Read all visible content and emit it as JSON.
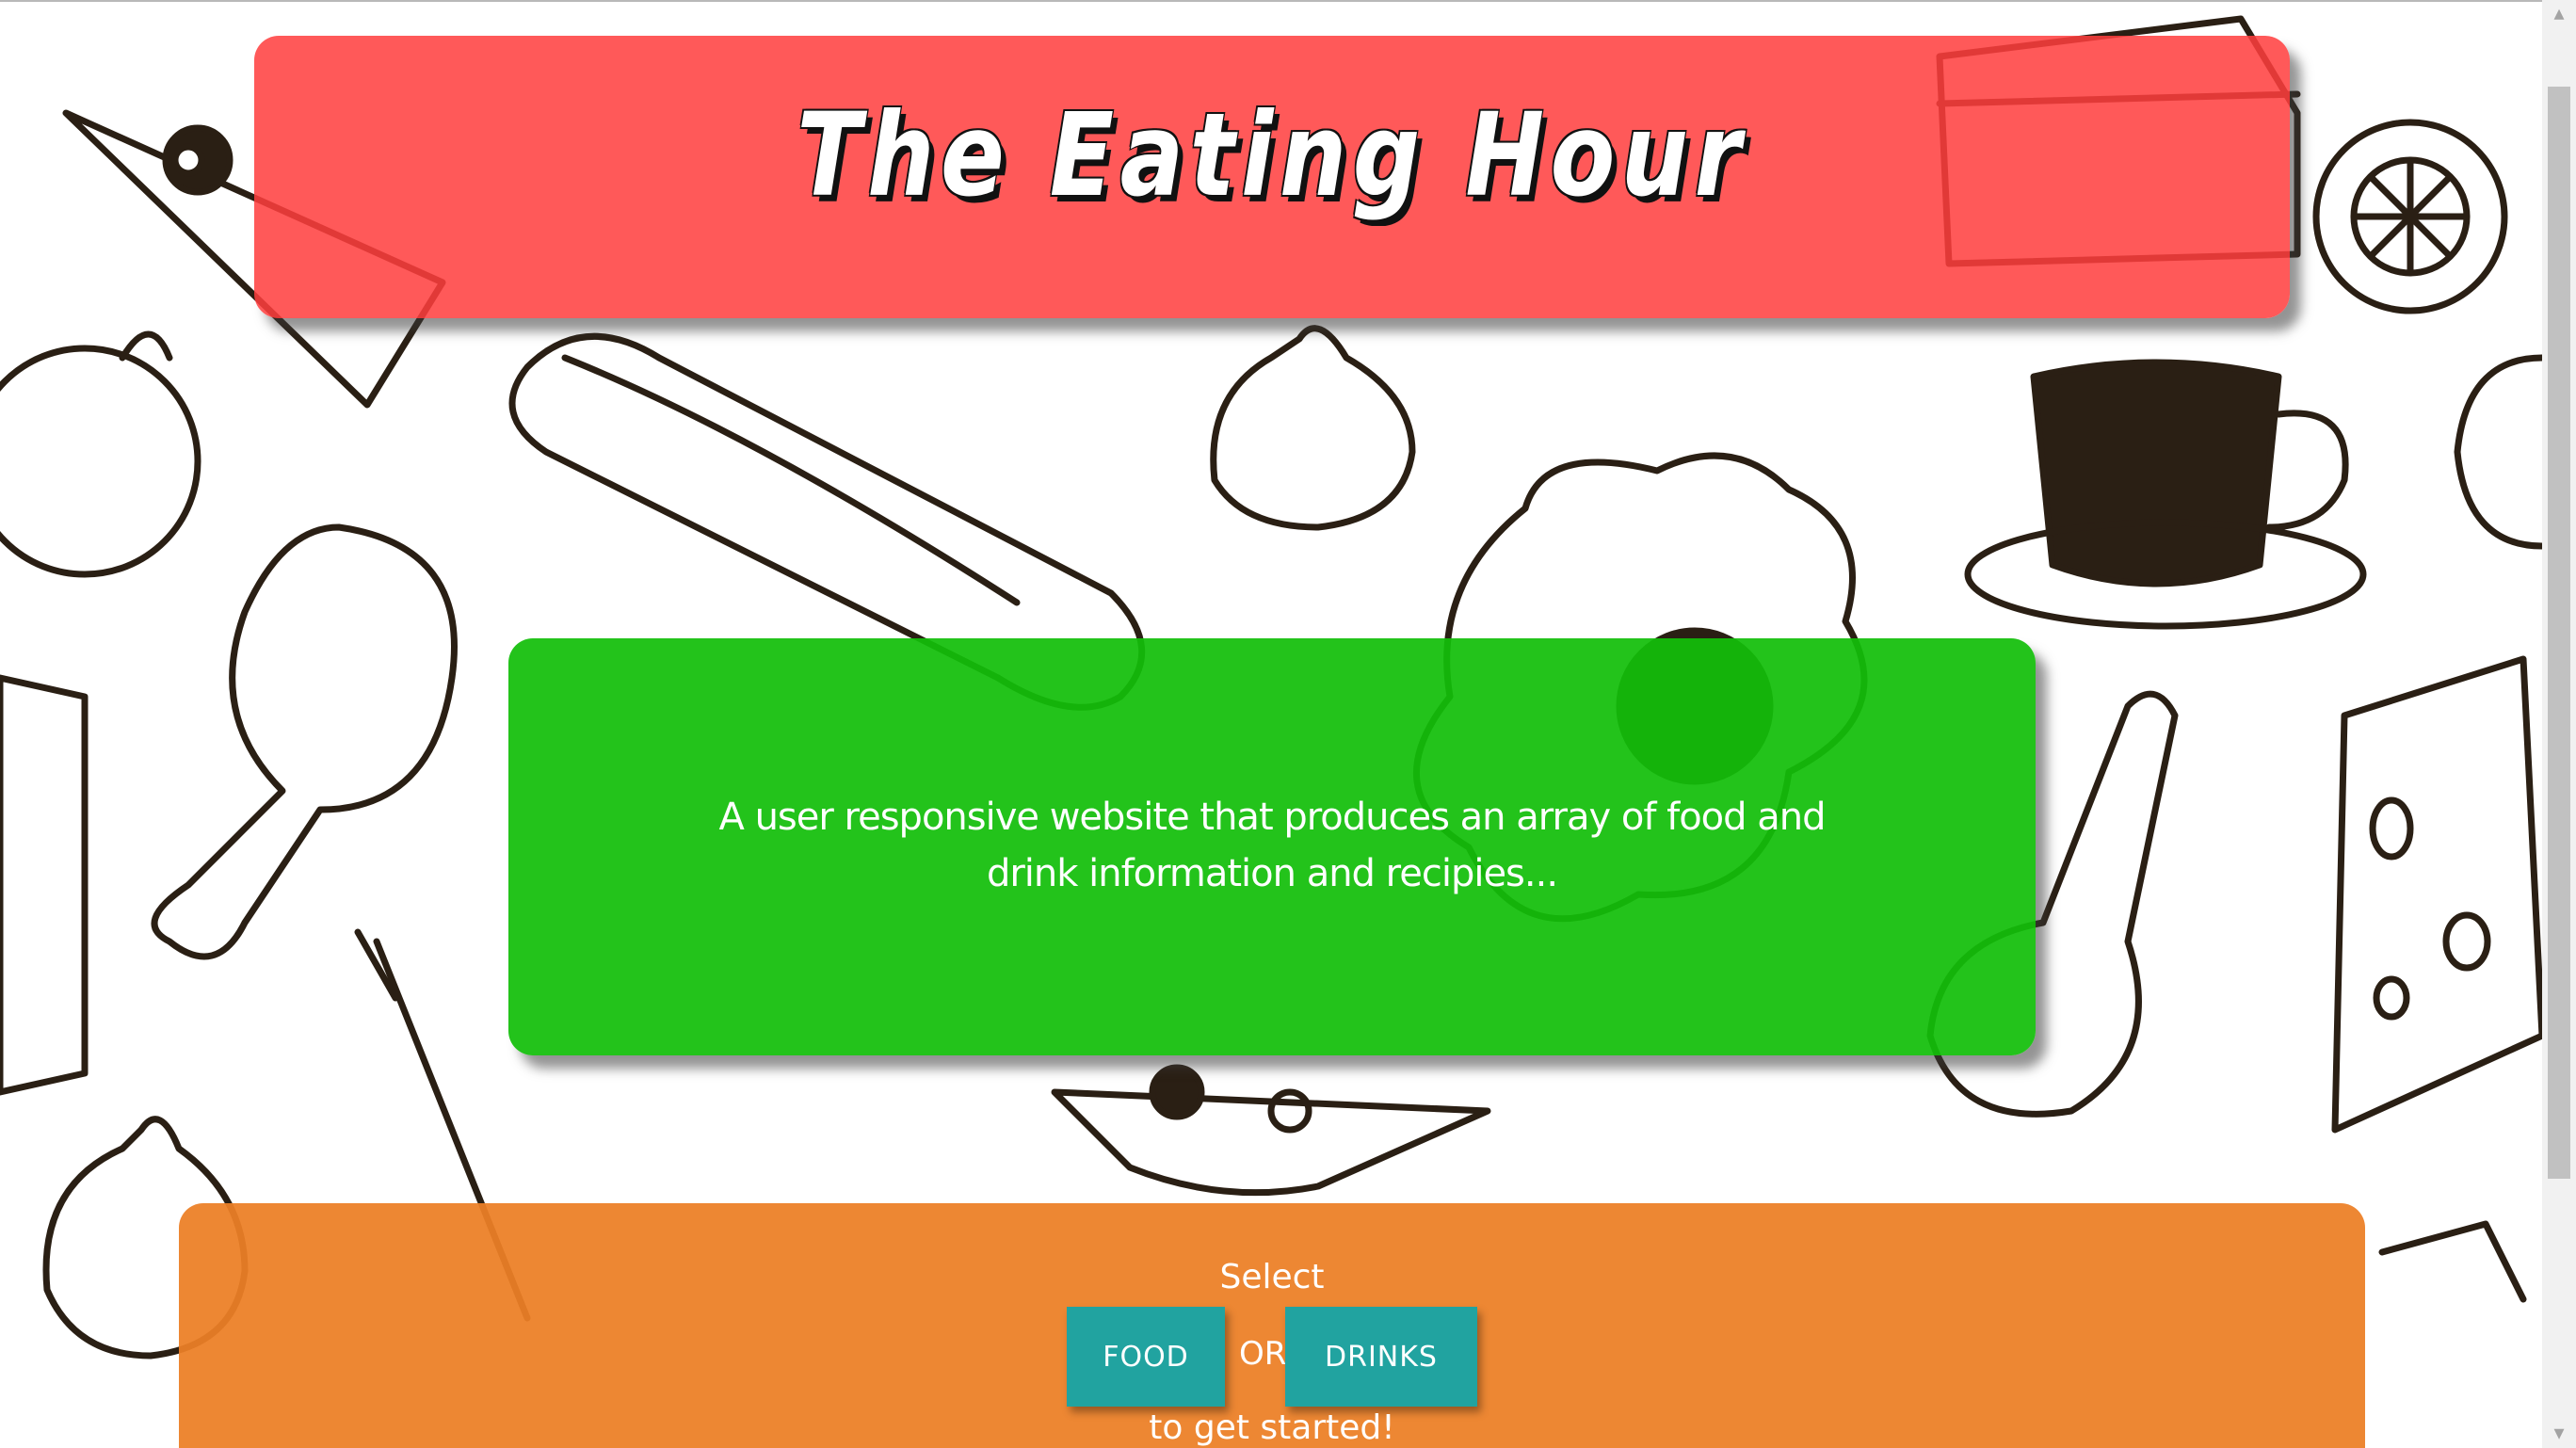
{
  "header": {
    "title": "The Eating Hour"
  },
  "intro": {
    "description": "A user responsive website that produces an array of food and drink information and recipies..."
  },
  "start": {
    "select_label": "Select",
    "food_button": "FOOD",
    "or_label": "OR",
    "drinks_button": "DRINKS",
    "after_label": "to get started!"
  },
  "colors": {
    "header_panel": "#ff3e3e",
    "description_panel": "#12be0a",
    "start_panel": "#ec8026",
    "button": "#21a3a0"
  },
  "icons": {
    "scroll_up": "chevron-up-icon",
    "scroll_down": "chevron-down-icon"
  }
}
